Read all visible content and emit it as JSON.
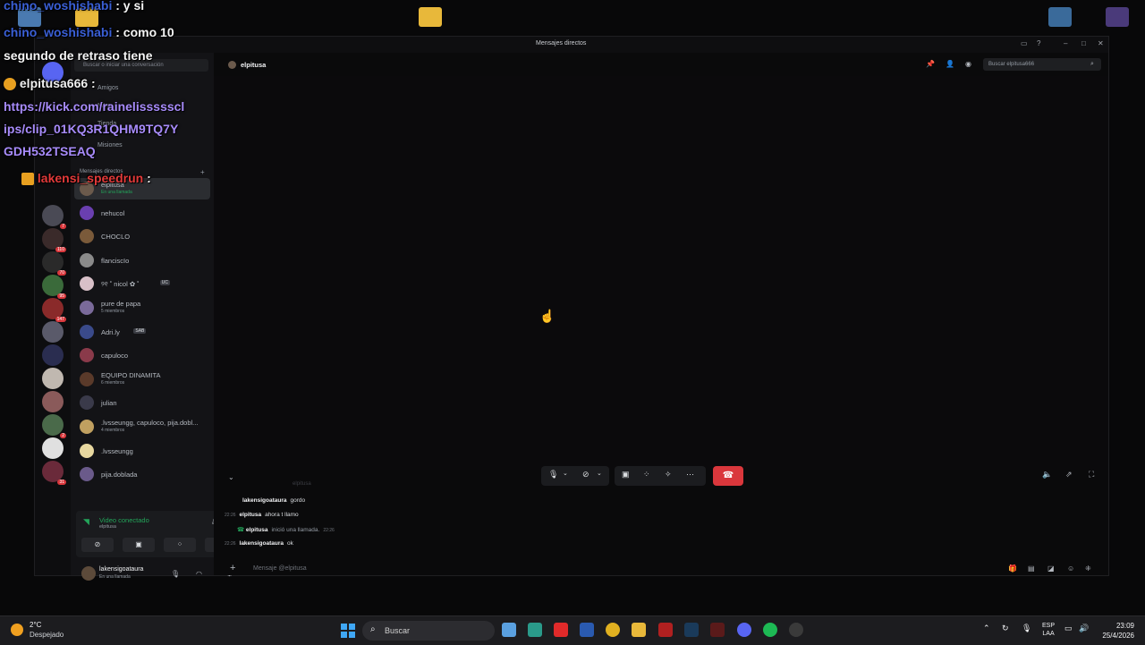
{
  "window": {
    "title": "Mensajes directos"
  },
  "sidebar": {
    "search_placeholder": "Buscar o iniciar una conversación",
    "nav": [
      "Amigos",
      "Nitro",
      "Tienda",
      "Misiones"
    ],
    "dm_section": "Mensajes directos",
    "dms": [
      {
        "name": "elpitusa",
        "sub": "En una llamada",
        "color": "#6b5a4c",
        "active": true
      },
      {
        "name": "nehucol",
        "sub": "",
        "color": "#6a3fb0"
      },
      {
        "name": "CHOCLO",
        "sub": "",
        "color": "#7a5a3a"
      },
      {
        "name": "flanciscIo",
        "sub": "",
        "color": "#8a8a8a"
      },
      {
        "name": "୨୧ ˚ nicol ✿ ˚",
        "sub": "",
        "tag": "UC",
        "color": "#d8c0c8"
      },
      {
        "name": "pure de papa",
        "sub": "5 miembros",
        "color": "#7a6a9a"
      },
      {
        "name": "Adri.ly",
        "sub": "",
        "tag": "SAB",
        "color": "#3a4a8a"
      },
      {
        "name": "capuloco",
        "sub": "",
        "color": "#8a3a4a"
      },
      {
        "name": "EQUIPO DINAMITA",
        "sub": "6 miembros",
        "color": "#5a3a2a"
      },
      {
        "name": "julian",
        "sub": "",
        "color": "#3a3a4a"
      },
      {
        "name": ".lvsseungg, capuloco, pija.dobl...",
        "sub": "4 miembros",
        "color": "#c0a060"
      },
      {
        "name": ".lvsseungg",
        "sub": "",
        "color": "#e8d8a0"
      },
      {
        "name": "pija.doblada",
        "sub": "",
        "color": "#6a5a8a"
      }
    ],
    "guild_badges": [
      "7",
      "110",
      "70",
      "95",
      "147",
      "2",
      "31"
    ],
    "voice": {
      "status": "Video conectado",
      "channel": "elpitusa"
    },
    "user": {
      "name": "lakensigoataura",
      "status": "En una llamada"
    }
  },
  "main": {
    "header_name": "elpitusa",
    "search_placeholder": "Buscar elpitusa666",
    "stage_label": "elpitusa",
    "messages": [
      {
        "time": "",
        "author": "lakensigoataura",
        "text": "gordo"
      },
      {
        "time": "22:26",
        "author": "elpitusa",
        "text": "ahora t llamo"
      },
      {
        "time": "",
        "author": "elpitusa",
        "text": "inició una llamada.",
        "system": true,
        "suffix": "22:26"
      },
      {
        "time": "22:26",
        "author": "lakensigoataura",
        "text": "ok"
      }
    ],
    "composer_placeholder": "Mensaje @elpitusa"
  },
  "overlay": {
    "lines": [
      {
        "user": "chino_woshishabi",
        "text": ": y si"
      },
      {
        "user": "chino_woshishabi",
        "text": ": como 10"
      },
      {
        "user": "",
        "text": "segundo de retraso tiene"
      },
      {
        "user": "elpitusa666",
        "text": ":"
      },
      {
        "user": "",
        "text": "https://kick.com/rainelisssss/clips/clip_01KQ3R1QHM9TQ7YGDH532TSEAQ"
      },
      {
        "user": "lakensi_speedrun",
        "text": ":"
      }
    ],
    "link_lines": [
      "https://kick.com/rainelissssscl",
      "ips/clip_01KQ3R1QHM9TQ7Y",
      "GDH532TSEAQ"
    ]
  },
  "taskbar": {
    "temp": "2°C",
    "weather": "Despejado",
    "search": "Buscar",
    "lang_1": "ESP",
    "lang_2": "LAA",
    "time": "23:09",
    "date": "25/4/2026"
  },
  "colors": {
    "hangup": "#da373c",
    "connected": "#23a55a",
    "accent": "#5865f2"
  }
}
